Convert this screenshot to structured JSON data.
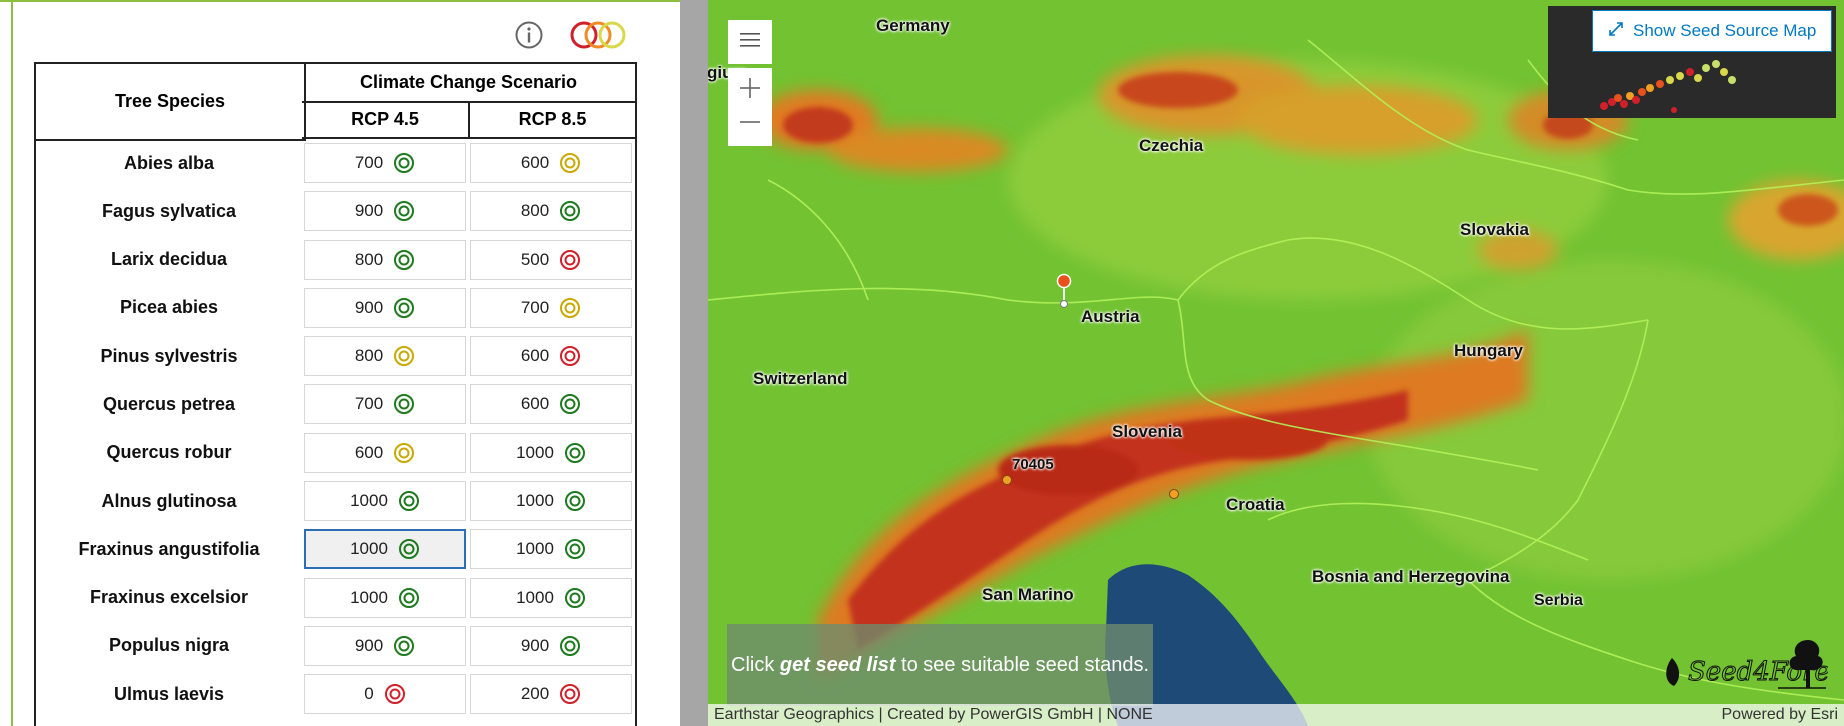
{
  "table": {
    "header_species": "Tree Species",
    "header_scenario": "Climate Change Scenario",
    "header_rcp45": "RCP 4.5",
    "header_rcp85": "RCP 8.5",
    "rows": [
      {
        "species": "Abies alba",
        "rcp45": "700",
        "rcp45_status": "green",
        "rcp85": "600",
        "rcp85_status": "yellow"
      },
      {
        "species": "Fagus sylvatica",
        "rcp45": "900",
        "rcp45_status": "green",
        "rcp85": "800",
        "rcp85_status": "green"
      },
      {
        "species": "Larix decidua",
        "rcp45": "800",
        "rcp45_status": "green",
        "rcp85": "500",
        "rcp85_status": "red"
      },
      {
        "species": "Picea abies",
        "rcp45": "900",
        "rcp45_status": "green",
        "rcp85": "700",
        "rcp85_status": "yellow"
      },
      {
        "species": "Pinus sylvestris",
        "rcp45": "800",
        "rcp45_status": "yellow",
        "rcp85": "600",
        "rcp85_status": "red"
      },
      {
        "species": "Quercus petrea",
        "rcp45": "700",
        "rcp45_status": "green",
        "rcp85": "600",
        "rcp85_status": "green"
      },
      {
        "species": "Quercus robur",
        "rcp45": "600",
        "rcp45_status": "yellow",
        "rcp85": "1000",
        "rcp85_status": "green"
      },
      {
        "species": "Alnus glutinosa",
        "rcp45": "1000",
        "rcp45_status": "green",
        "rcp85": "1000",
        "rcp85_status": "green"
      },
      {
        "species": "Fraxinus angustifolia",
        "rcp45": "1000",
        "rcp45_status": "green",
        "rcp85": "1000",
        "rcp85_status": "green",
        "selected": "rcp45"
      },
      {
        "species": "Fraxinus excelsior",
        "rcp45": "1000",
        "rcp45_status": "green",
        "rcp85": "1000",
        "rcp85_status": "green"
      },
      {
        "species": "Populus nigra",
        "rcp45": "900",
        "rcp45_status": "green",
        "rcp85": "900",
        "rcp85_status": "green"
      },
      {
        "species": "Ulmus laevis",
        "rcp45": "0",
        "rcp45_status": "red",
        "rcp85": "200",
        "rcp85_status": "red"
      }
    ]
  },
  "status_colors": {
    "green": "#1e7a1e",
    "yellow": "#c9a800",
    "red": "#d0202a"
  },
  "toolbar": {
    "info_icon": "info-icon",
    "rings_icon": "rings-icon"
  },
  "map": {
    "labels": {
      "germany": "Germany",
      "czechia": "Czechia",
      "slovakia": "Slovakia",
      "austria": "Austria",
      "hungary": "Hungary",
      "switzerland": "Switzerland",
      "slovenia": "Slovenia",
      "croatia": "Croatia",
      "bosnia": "Bosnia and Herzegovina",
      "serbia": "Serbia",
      "san_marino": "San Marino",
      "belgium_partial": "gium",
      "stand_id": "70405"
    },
    "show_button": "Show Seed Source Map",
    "hint_prefix": "Click ",
    "hint_emphasis": "get seed list",
    "hint_suffix": " to see suitable seed stands.",
    "attribution": "Earthstar Geographics | Created by PowerGIS GmbH | NONE",
    "powered_by": "Powered by Esri",
    "logo_text": "Seed4Forest"
  }
}
